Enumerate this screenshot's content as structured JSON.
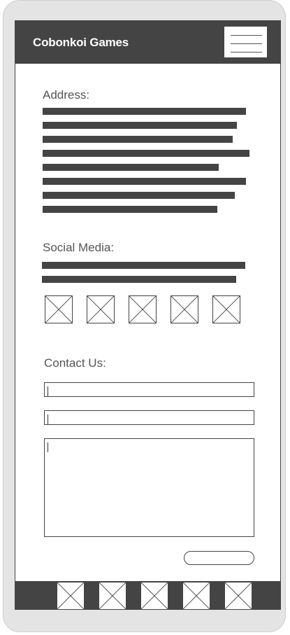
{
  "header": {
    "title": "Cobonkoi Games",
    "menu_icon": "hamburger-icon"
  },
  "address": {
    "label": "Address:"
  },
  "social": {
    "label": "Social Media:",
    "icons": [
      "image-placeholder-icon",
      "image-placeholder-icon",
      "image-placeholder-icon",
      "image-placeholder-icon",
      "image-placeholder-icon"
    ]
  },
  "contact": {
    "label": "Contact Us:",
    "field1_value": "",
    "field2_value": "",
    "message_value": "",
    "submit_label": ""
  },
  "footer": {
    "icons": [
      "image-placeholder-icon",
      "image-placeholder-icon",
      "image-placeholder-icon",
      "image-placeholder-icon",
      "image-placeholder-icon"
    ]
  },
  "colors": {
    "header_bg": "#444444",
    "frame": "#e4e4e4",
    "text": "#555555"
  }
}
